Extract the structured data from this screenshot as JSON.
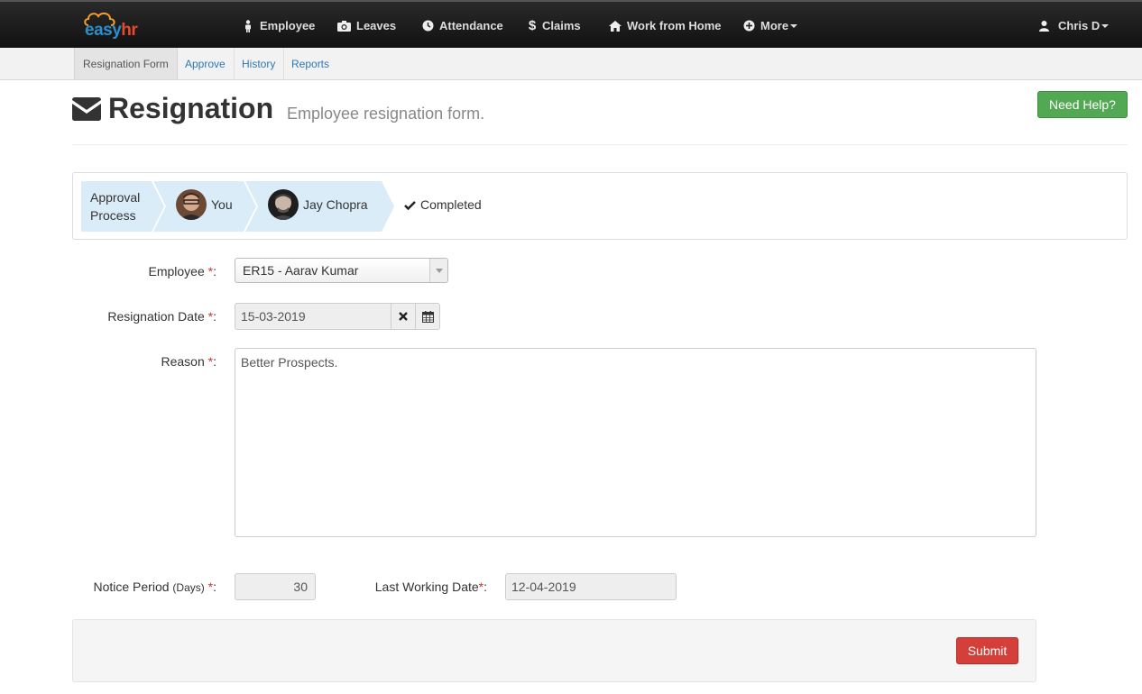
{
  "app": {
    "logo_text_1": "easy",
    "logo_text_2": "hr"
  },
  "topnav": {
    "items": [
      {
        "label": "Employee",
        "icon": "person-icon"
      },
      {
        "label": "Leaves",
        "icon": "camera-icon"
      },
      {
        "label": "Attendance",
        "icon": "clock-icon"
      },
      {
        "label": "Claims",
        "icon": "dollar-icon"
      },
      {
        "label": "Work from Home",
        "icon": "home-icon"
      },
      {
        "label": "More",
        "icon": "plus-circle-icon"
      }
    ],
    "user": "Chris D"
  },
  "subnav": {
    "tabs": [
      "Resignation Form",
      "Approve",
      "History",
      "Reports"
    ],
    "active": "Resignation Form"
  },
  "header": {
    "title": "Resignation",
    "subtitle": "Employee resignation form.",
    "help_label": "Need Help?"
  },
  "approval": {
    "title_line1": "Approval",
    "title_line2": "Process",
    "steps": [
      "You",
      "Jay Chopra"
    ],
    "completed_label": "Completed"
  },
  "form": {
    "employee_label": "Employee",
    "employee_value": "ER15 - Aarav Kumar",
    "resignation_date_label": "Resignation Date",
    "resignation_date_value": "15-03-2019",
    "reason_label": "Reason",
    "reason_value": "Better Prospects.",
    "notice_label": "Notice Period",
    "notice_unit": "(Days)",
    "notice_value": "30",
    "last_working_label": "Last Working Date",
    "last_working_value": "12-04-2019",
    "required_mark": "*",
    "colon": ":",
    "submit_label": "Submit"
  },
  "colors": {
    "topbar": "#1c1c1c",
    "help_button": "#53a953",
    "submit_button": "#d43f3a",
    "approval_step": "#d9ecf8",
    "link": "#2f78b8"
  }
}
